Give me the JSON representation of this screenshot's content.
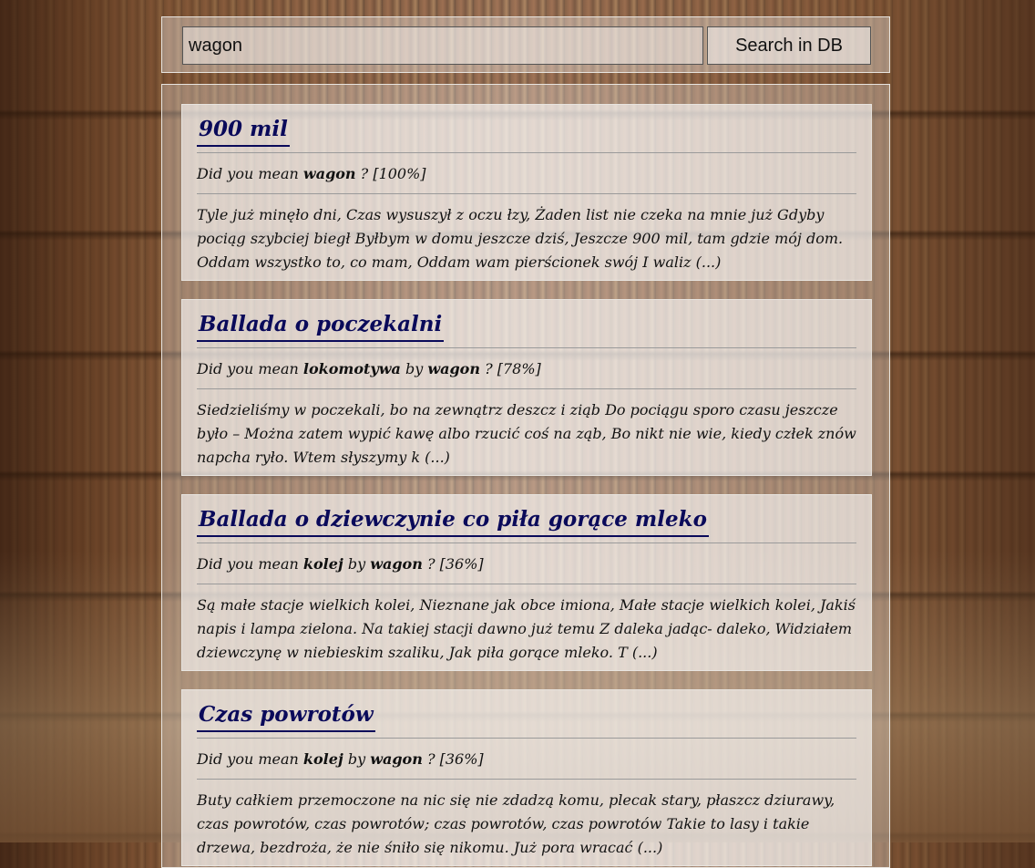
{
  "search": {
    "value": "wagon",
    "button_label": "Search in DB"
  },
  "results": [
    {
      "title": "900 mil",
      "suggestion": {
        "prefix": "Did you mean",
        "terms": [
          "wagon"
        ],
        "joiners": [],
        "score": "? [100%]"
      },
      "excerpt": "Tyle już minęło dni, Czas wysuszył z oczu łzy, Żaden list nie czeka na mnie już Gdyby pociąg szybciej biegł Byłbym w domu jeszcze dziś, Jeszcze 900 mil, tam gdzie mój dom. Oddam wszystko to, co mam, Oddam wam pierścionek swój I waliz (...)"
    },
    {
      "title": "Ballada o poczekalni",
      "suggestion": {
        "prefix": "Did you mean",
        "terms": [
          "lokomotywa",
          "wagon"
        ],
        "joiners": [
          "by"
        ],
        "score": "? [78%]"
      },
      "excerpt": "Siedzieliśmy w poczekali, bo na zewnątrz deszcz i ziąb Do pociągu sporo czasu jeszcze było – Można zatem wypić kawę albo rzucić coś na ząb, Bo nikt nie wie, kiedy człek znów napcha ryło. Wtem słyszymy k (...)"
    },
    {
      "title": "Ballada o dziewczynie co piła gorące mleko",
      "suggestion": {
        "prefix": "Did you mean",
        "terms": [
          "kolej",
          "wagon"
        ],
        "joiners": [
          "by"
        ],
        "score": "? [36%]"
      },
      "excerpt": "Są małe stacje wielkich kolei, Nieznane jak obce imiona, Małe stacje wielkich kolei, Jakiś napis i lampa zielona. Na takiej stacji dawno już temu Z daleka jadąc- daleko, Widziałem dziewczynę w niebieskim szaliku, Jak piła gorące mleko. T (...)"
    },
    {
      "title": "Czas powrotów",
      "suggestion": {
        "prefix": "Did you mean",
        "terms": [
          "kolej",
          "wagon"
        ],
        "joiners": [
          "by"
        ],
        "score": "? [36%]"
      },
      "excerpt": "Buty całkiem przemoczone na nic się nie zdadzą komu, plecak stary, płaszcz dziurawy, czas powrotów, czas powrotów; czas powrotów, czas powrotów Takie to lasy i takie drzewa, bezdroża, że nie śniło się nikomu. Już pora wracać (...)"
    }
  ]
}
